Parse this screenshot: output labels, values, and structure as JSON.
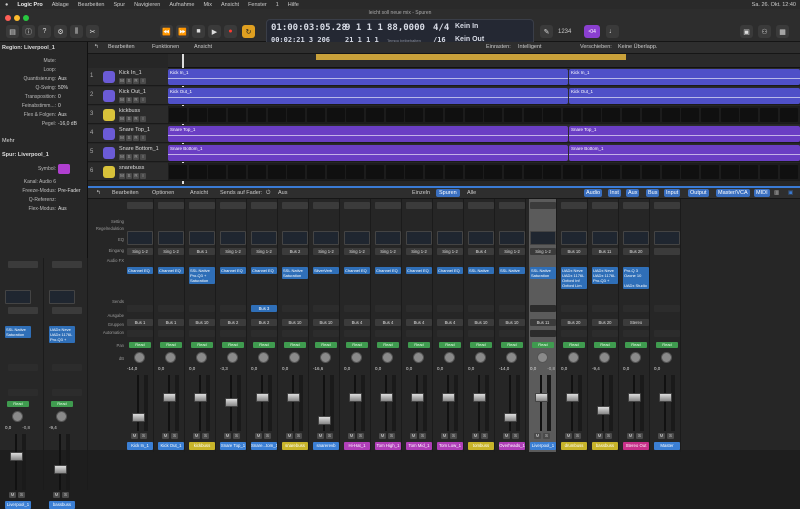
{
  "menubar": {
    "app": "Logic Pro",
    "items": [
      "Ablage",
      "Bearbeiten",
      "Spur",
      "Navigieren",
      "Aufnahme",
      "Mix",
      "Ansicht",
      "Fenster",
      "1",
      "Hilfe"
    ],
    "clock": "Sa. 26. Okt. 12:40"
  },
  "window": {
    "title": "leicht soll neue mix - Spuren"
  },
  "lcd": {
    "time": "01:00:03:05.28",
    "bars": "9  1  1  1",
    "time2": "00:02:21  3 206",
    "bars2": "21  1  1  1",
    "tempo": "88,0000",
    "tempo_label": "Tempo beibehalten",
    "sig": "4/4",
    "div": "/16",
    "in": "Kein In",
    "out": "Kein Out"
  },
  "toolbar": {
    "count": "1234",
    "key_badge": "⁴04"
  },
  "inspector": {
    "region_header": "Region: Liverpool_1",
    "rows": [
      {
        "label": "Mute:",
        "value": ""
      },
      {
        "label": "Loop:",
        "value": ""
      },
      {
        "label": "Quantisierung:",
        "value": "Aus"
      },
      {
        "label": "Q-Swing:",
        "value": "50%"
      },
      {
        "label": "Transposition:",
        "value": "0"
      },
      {
        "label": "Feinabstimm...:",
        "value": "0"
      },
      {
        "label": "Flex & Folgen:",
        "value": "Aus"
      },
      {
        "label": "Pegel:",
        "value": "-16,0 dB"
      }
    ],
    "mehr": "Mehr",
    "track_header": "Spur: Liverpool_1",
    "track_rows": [
      {
        "label": "Symbol:",
        "value": ""
      },
      {
        "label": "Kanal: Audio 6",
        "value": ""
      },
      {
        "label": "Freeze-Modus:",
        "value": "Pre-Fader"
      },
      {
        "label": "Q-Referenz:",
        "value": ""
      },
      {
        "label": "Flex-Modus:",
        "value": "Aus"
      }
    ],
    "strips": [
      {
        "fx": "SSL Native\nSaturation",
        "bus": "Bus 11",
        "read": "Read",
        "db": "0,0",
        "peak": "-0,8",
        "name": "Liverpool_1",
        "color": "#3b7fd4"
      },
      {
        "fx": "UADx Neve\nUADx 1176L\nPro-Q3 +",
        "bus": "Bus 20",
        "read": "Read",
        "db": "-9,4",
        "peak": "",
        "name": "bassbuss",
        "color": "#3b7fd4"
      }
    ]
  },
  "tracks_toolbar": {
    "edit": "Bearbeiten",
    "functions": "Funktionen",
    "view": "Ansicht",
    "snap_label": "Einrasten:",
    "snap": "Intelligent",
    "move_label": "Verschieben:",
    "move": "Keine Überlapp."
  },
  "tracks": [
    {
      "num": "1",
      "name": "Kick In_1",
      "color": "#6b5bd6",
      "region": "Kick In_1",
      "rcolor": "#4f50c8"
    },
    {
      "num": "2",
      "name": "Kick Out_1",
      "color": "#6b5bd6",
      "region": "Kick Out_1",
      "rcolor": "#4f50c8"
    },
    {
      "num": "3",
      "name": "kickbuss",
      "color": "#d8c23a",
      "region": "",
      "rcolor": "#3a3a3a"
    },
    {
      "num": "4",
      "name": "Snare Top_1",
      "color": "#6b5bd6",
      "region": "Snare Top_1",
      "rcolor": "#6a3ec4"
    },
    {
      "num": "5",
      "name": "Snare Bottom_1",
      "color": "#6b5bd6",
      "region": "Snare Bottom_1",
      "rcolor": "#6a3ec4"
    },
    {
      "num": "6",
      "name": "snarebuss",
      "color": "#d8c23a",
      "region": "",
      "rcolor": "#3a3a3a"
    }
  ],
  "mixer": {
    "edit": "Bearbeiten",
    "options": "Optionen",
    "view": "Ansicht",
    "sends_label": "Sends auf Fader:",
    "sends": "Aus",
    "single": "Einzeln",
    "tracks": "Spuren",
    "all": "Alle",
    "filters": [
      "Audio",
      "Inst",
      "Aux",
      "Bus",
      "Input",
      "Output",
      "Master/VCA",
      "MIDI"
    ],
    "row_labels": [
      "Setting",
      "Regelreduktion",
      "EQ",
      "Eingang",
      "Audio FX",
      "Sends",
      "Ausgabe",
      "Gruppen",
      "Automation",
      "Pan",
      "dB"
    ],
    "strips": [
      {
        "in": "Sing 1-2",
        "fx": "Channel EQ",
        "out": "Bus 1",
        "db": "-14,0",
        "peak": "",
        "name": "Kick In_1",
        "color": "#3b7fd4"
      },
      {
        "in": "Sing 1-2",
        "fx": "Channel EQ",
        "out": "Bus 1",
        "db": "0,0",
        "peak": "",
        "name": "Kick Out_1",
        "color": "#3b7fd4"
      },
      {
        "in": "Bus 1",
        "fx": "SSL Native\nPro-Q3 +\nSaturation",
        "out": "Bus 10",
        "db": "0,0",
        "peak": "",
        "name": "kickbuss",
        "color": "#c8b42a"
      },
      {
        "in": "Sing 1-2",
        "fx": "Channel EQ",
        "out": "Bus 2",
        "db": "-3,3",
        "peak": "",
        "name": "Snare Top_1",
        "color": "#3b7fd4"
      },
      {
        "in": "Sing 1-2",
        "fx": "Channel EQ",
        "out": "Bus 2",
        "db": "0,0",
        "peak": "",
        "name": "Snare...tom_1",
        "color": "#3b7fd4"
      },
      {
        "in": "Bus 2",
        "fx": "SSL Native\nSaturation",
        "out": "Bus 10",
        "db": "0,0",
        "peak": "",
        "name": "snarebuss",
        "color": "#c8b42a"
      },
      {
        "in": "Sing 1-2",
        "fx": "SilverVerb",
        "out": "Bus 10",
        "db": "-16,6",
        "peak": "",
        "name": "snarerevb",
        "color": "#3b7fd4"
      },
      {
        "in": "Sing 1-2",
        "fx": "Channel EQ",
        "out": "Bus 4",
        "db": "0,0",
        "peak": "",
        "name": "Hi-Hat_1",
        "color": "#b03fb8"
      },
      {
        "in": "Sing 1-2",
        "fx": "Channel EQ",
        "out": "Bus 4",
        "db": "0,0",
        "peak": "",
        "name": "Tom High_1",
        "color": "#b03fb8"
      },
      {
        "in": "Sing 1-2",
        "fx": "Channel EQ",
        "out": "Bus 4",
        "db": "0,0",
        "peak": "",
        "name": "Tom Mid_1",
        "color": "#b03fb8"
      },
      {
        "in": "Sing 1-2",
        "fx": "Channel EQ",
        "out": "Bus 4",
        "db": "0,0",
        "peak": "",
        "name": "Tom Low_1",
        "color": "#b03fb8"
      },
      {
        "in": "Bus 4",
        "fx": "SSL Native",
        "out": "Bus 10",
        "db": "0,0",
        "peak": "",
        "name": "tombuss",
        "color": "#c8b42a"
      },
      {
        "in": "Sing 1-2",
        "fx": "SSL Native",
        "out": "Bus 10",
        "db": "-14,0",
        "peak": "",
        "name": "Overheads_1",
        "color": "#b03fb8"
      },
      {
        "in": "Sing 1-2",
        "fx": "SSL Native\nSaturation",
        "out": "Bus 11",
        "db": "0,0",
        "peak": "-0,8",
        "name": "Liverpool_1",
        "color": "#3b7fd4"
      },
      {
        "in": "Bus 10",
        "fx": "UADx Neve\nUADx 1176L\nOxford Inf\nOxford Lim",
        "out": "Bus 20",
        "db": "0,0",
        "peak": "",
        "name": "drumbuss",
        "color": "#c8b42a"
      },
      {
        "in": "Bus 11",
        "fx": "UADx Neve\nUADx 1176L\nPro-Q3 +",
        "out": "Bus 20",
        "db": "-9,4",
        "peak": "",
        "name": "bassbuss",
        "color": "#c8b42a"
      },
      {
        "in": "Bus 20",
        "fx": "Pro-Q 3\nOzone 10\n\nUADx Studio",
        "out": "Stereo",
        "db": "0,0",
        "peak": "",
        "name": "Stereo Out",
        "color": "#c8308a"
      },
      {
        "in": "",
        "fx": "",
        "out": "",
        "db": "0,0",
        "peak": "",
        "name": "Master",
        "color": "#3b7fd4"
      }
    ],
    "send_bus": "Bus 3"
  }
}
